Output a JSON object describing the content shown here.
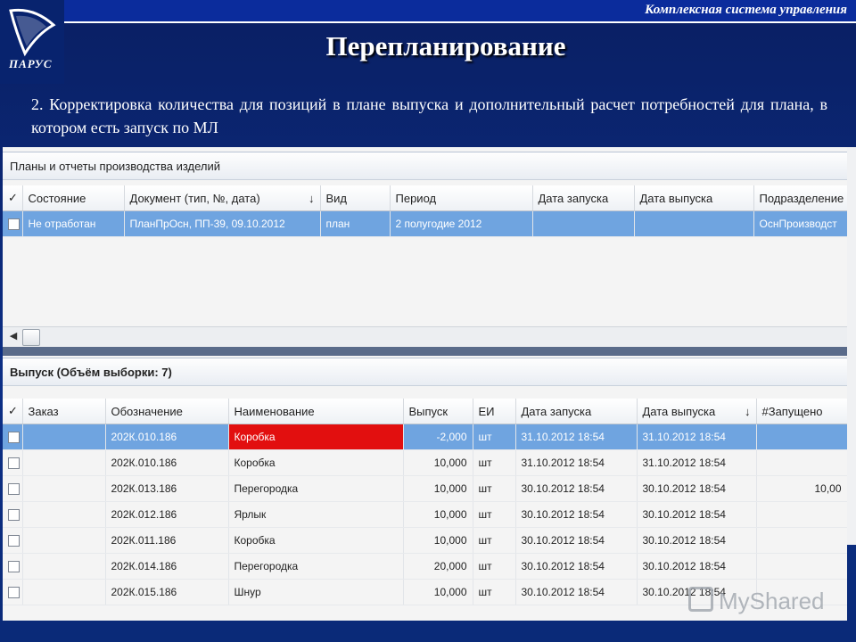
{
  "header": {
    "system_title": "Комплексная система управления",
    "logo_text": "ПАРУС",
    "page_title": "Перепланирование",
    "description": "2. Корректировка количества для позиций в плане выпуска и дополнительный расчет потребностей для плана, в котором есть запуск по МЛ"
  },
  "plans_panel": {
    "title": "Планы и отчеты производства изделий",
    "columns": [
      "✓",
      "Состояние",
      "Документ (тип, №, дата)",
      "Вид",
      "Период",
      "Дата запуска",
      "Дата выпуска",
      "Подразделение"
    ],
    "sort_indicator": "↓",
    "rows": [
      {
        "state": "Не отработан",
        "document": "ПланПрОсн, ПП-39, 09.10.2012",
        "kind": "план",
        "period": "2 полугодие 2012",
        "launch_date": "",
        "release_date": "",
        "department": "ОснПроизводст"
      }
    ]
  },
  "output_panel": {
    "title": "Выпуск (Объём выборки: 7)",
    "columns": [
      "✓",
      "Заказ",
      "Обозначение",
      "Наименование",
      "Выпуск",
      "ЕИ",
      "Дата запуска",
      "Дата выпуска",
      "#Запущено"
    ],
    "sort_indicator": "↓",
    "rows": [
      {
        "order": "",
        "code": "202К.010.186",
        "name": "Коробка",
        "qty": "-2,000",
        "unit": "шт",
        "launch": "31.10.2012 18:54",
        "release": "31.10.2012 18:54",
        "launched": ""
      },
      {
        "order": "",
        "code": "202К.010.186",
        "name": "Коробка",
        "qty": "10,000",
        "unit": "шт",
        "launch": "31.10.2012 18:54",
        "release": "31.10.2012 18:54",
        "launched": ""
      },
      {
        "order": "",
        "code": "202К.013.186",
        "name": "Перегородка",
        "qty": "10,000",
        "unit": "шт",
        "launch": "30.10.2012 18:54",
        "release": "30.10.2012 18:54",
        "launched": "10,00"
      },
      {
        "order": "",
        "code": "202К.012.186",
        "name": "Ярлык",
        "qty": "10,000",
        "unit": "шт",
        "launch": "30.10.2012 18:54",
        "release": "30.10.2012 18:54",
        "launched": ""
      },
      {
        "order": "",
        "code": "202К.011.186",
        "name": "Коробка",
        "qty": "10,000",
        "unit": "шт",
        "launch": "30.10.2012 18:54",
        "release": "30.10.2012 18:54",
        "launched": ""
      },
      {
        "order": "",
        "code": "202К.014.186",
        "name": "Перегородка",
        "qty": "20,000",
        "unit": "шт",
        "launch": "30.10.2012 18:54",
        "release": "30.10.2012 18:54",
        "launched": ""
      },
      {
        "order": "",
        "code": "202К.015.186",
        "name": "Шнур",
        "qty": "10,000",
        "unit": "шт",
        "launch": "30.10.2012 18:54",
        "release": "30.10.2012 18:54",
        "launched": ""
      }
    ]
  },
  "scrollbar": {
    "left_arrow": "◀"
  },
  "watermark": "MyShared"
}
